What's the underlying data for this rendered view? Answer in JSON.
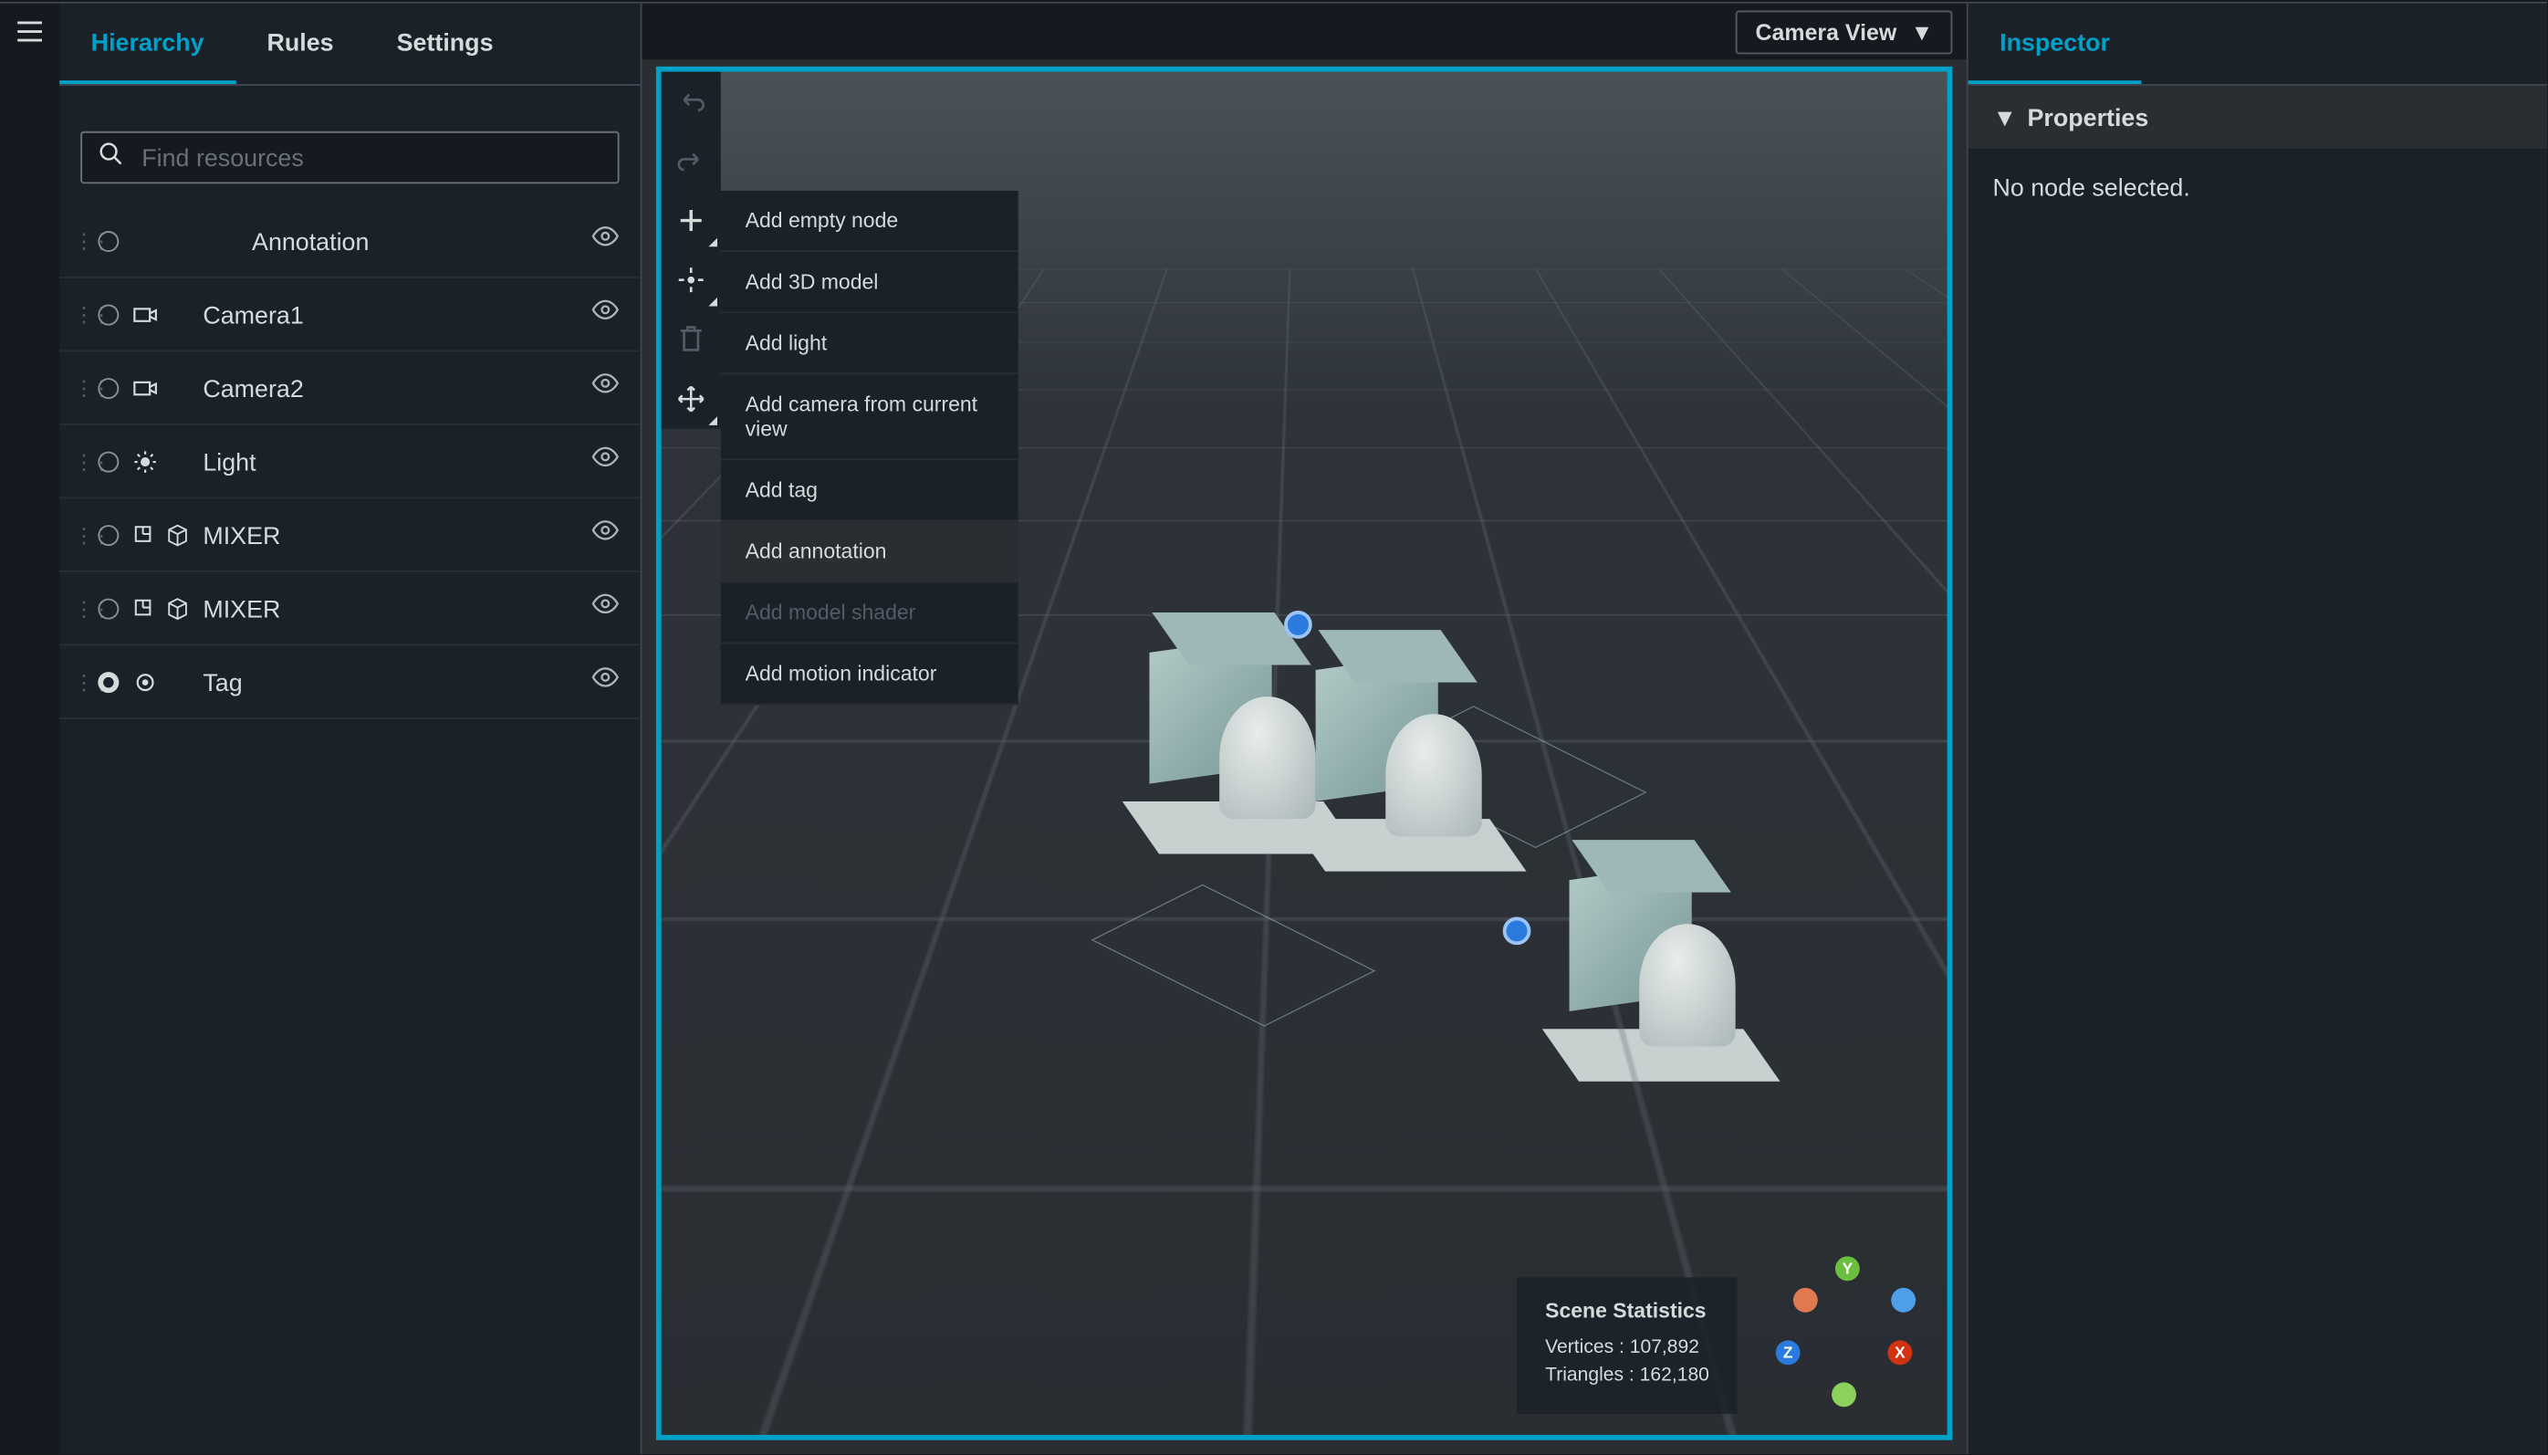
{
  "leftTabs": {
    "hierarchy": "Hierarchy",
    "rules": "Rules",
    "settings": "Settings"
  },
  "search": {
    "placeholder": "Find resources"
  },
  "hierarchy": [
    {
      "label": "Annotation",
      "icon": "none",
      "indent": true,
      "filled": false
    },
    {
      "label": "Camera1",
      "icon": "camera",
      "indent": false,
      "filled": false
    },
    {
      "label": "Camera2",
      "icon": "camera",
      "indent": false,
      "filled": false
    },
    {
      "label": "Light",
      "icon": "light",
      "indent": false,
      "filled": false
    },
    {
      "label": "MIXER",
      "icon": "model",
      "indent": false,
      "filled": false
    },
    {
      "label": "MIXER",
      "icon": "model",
      "indent": false,
      "filled": false
    },
    {
      "label": "Tag",
      "icon": "tag",
      "indent": false,
      "filled": true
    }
  ],
  "cameraViewLabel": "Camera View",
  "addMenu": {
    "emptyNode": "Add empty node",
    "model3d": "Add 3D model",
    "light": "Add light",
    "camera": "Add camera from current view",
    "tag": "Add tag",
    "annotation": "Add annotation",
    "shader": "Add model shader",
    "motion": "Add motion indicator"
  },
  "stats": {
    "title": "Scene Statistics",
    "vertices_label": "Vertices :",
    "vertices_value": "107,892",
    "triangles_label": "Triangles :",
    "triangles_value": "162,180"
  },
  "axis": {
    "x": "X",
    "y": "Y",
    "z": "Z"
  },
  "rightTabs": {
    "inspector": "Inspector"
  },
  "inspector": {
    "propsTitle": "Properties",
    "noSelection": "No node selected."
  }
}
